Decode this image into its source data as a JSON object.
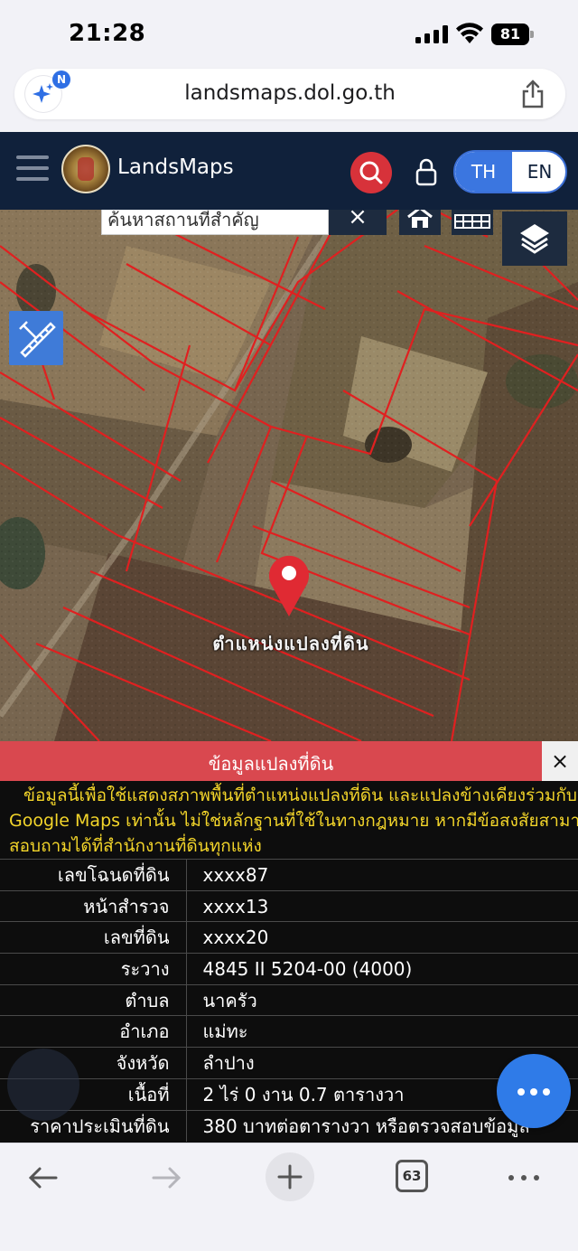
{
  "status_bar": {
    "time": "21:28",
    "battery": "81"
  },
  "browser": {
    "url": "landsmaps.dol.go.th",
    "ai_badge": "N",
    "tab_count": "63"
  },
  "app": {
    "brand": "LandsMaps",
    "lang_th": "TH",
    "lang_en": "EN"
  },
  "map": {
    "search_placeholder": "ค้นหาสถานที่สำคัญ",
    "clear_label": "×",
    "pin_label": "ตำแหน่งแปลงที่ดิน"
  },
  "panel": {
    "title": "ข้อมูลแปลงที่ดิน",
    "close_label": "×",
    "notice_lines": [
      "ข้อมูลนี้เพื่อใช้แสดงสภาพพื้นที่ตำแหน่งแปลงที่ดิน และแปลงข้างเคียงร่วมกับ",
      "Google Maps เท่านั้น ไม่ใช่หลักฐานที่ใช้ในทางกฎหมาย หากมีข้อสงสัยสามารถ",
      "สอบถามได้ที่สำนักงานที่ดินทุกแห่ง"
    ],
    "rows": [
      {
        "label": "เลขโฉนดที่ดิน",
        "value": "xxxx87"
      },
      {
        "label": "หน้าสำรวจ",
        "value": "xxxx13"
      },
      {
        "label": "เลขที่ดิน",
        "value": "xxxx20"
      },
      {
        "label": "ระวาง",
        "value": "4845 II 5204-00 (4000)"
      },
      {
        "label": "ตำบล",
        "value": "นาครัว"
      },
      {
        "label": "อำเภอ",
        "value": "แม่ทะ"
      },
      {
        "label": "จังหวัด",
        "value": "ลำปาง"
      },
      {
        "label": "เนื้อที่",
        "value": "2 ไร่ 0 งาน 0.7 ตารางวา"
      },
      {
        "label": "ราคาประเมินที่ดิน",
        "value": "380 บาทต่อตารางวา หรือตรวจสอบข้อมูล"
      }
    ]
  },
  "colors": {
    "header_bg": "#10213b",
    "accent_blue": "#3b76e0",
    "search_red": "#d7323a",
    "panel_red": "#d9484f",
    "notice_yellow": "#f3d52a",
    "parcel_line": "#e02020"
  },
  "icons": [
    "ai-sparkle-icon",
    "share-icon",
    "hamburger-icon",
    "search-icon",
    "lock-icon",
    "home-icon",
    "grid-icon",
    "layers-icon",
    "measure-icon",
    "map-pin-icon",
    "more-icon",
    "back-arrow-icon",
    "forward-arrow-icon",
    "plus-icon",
    "tabs-icon",
    "ellipsis-icon"
  ]
}
